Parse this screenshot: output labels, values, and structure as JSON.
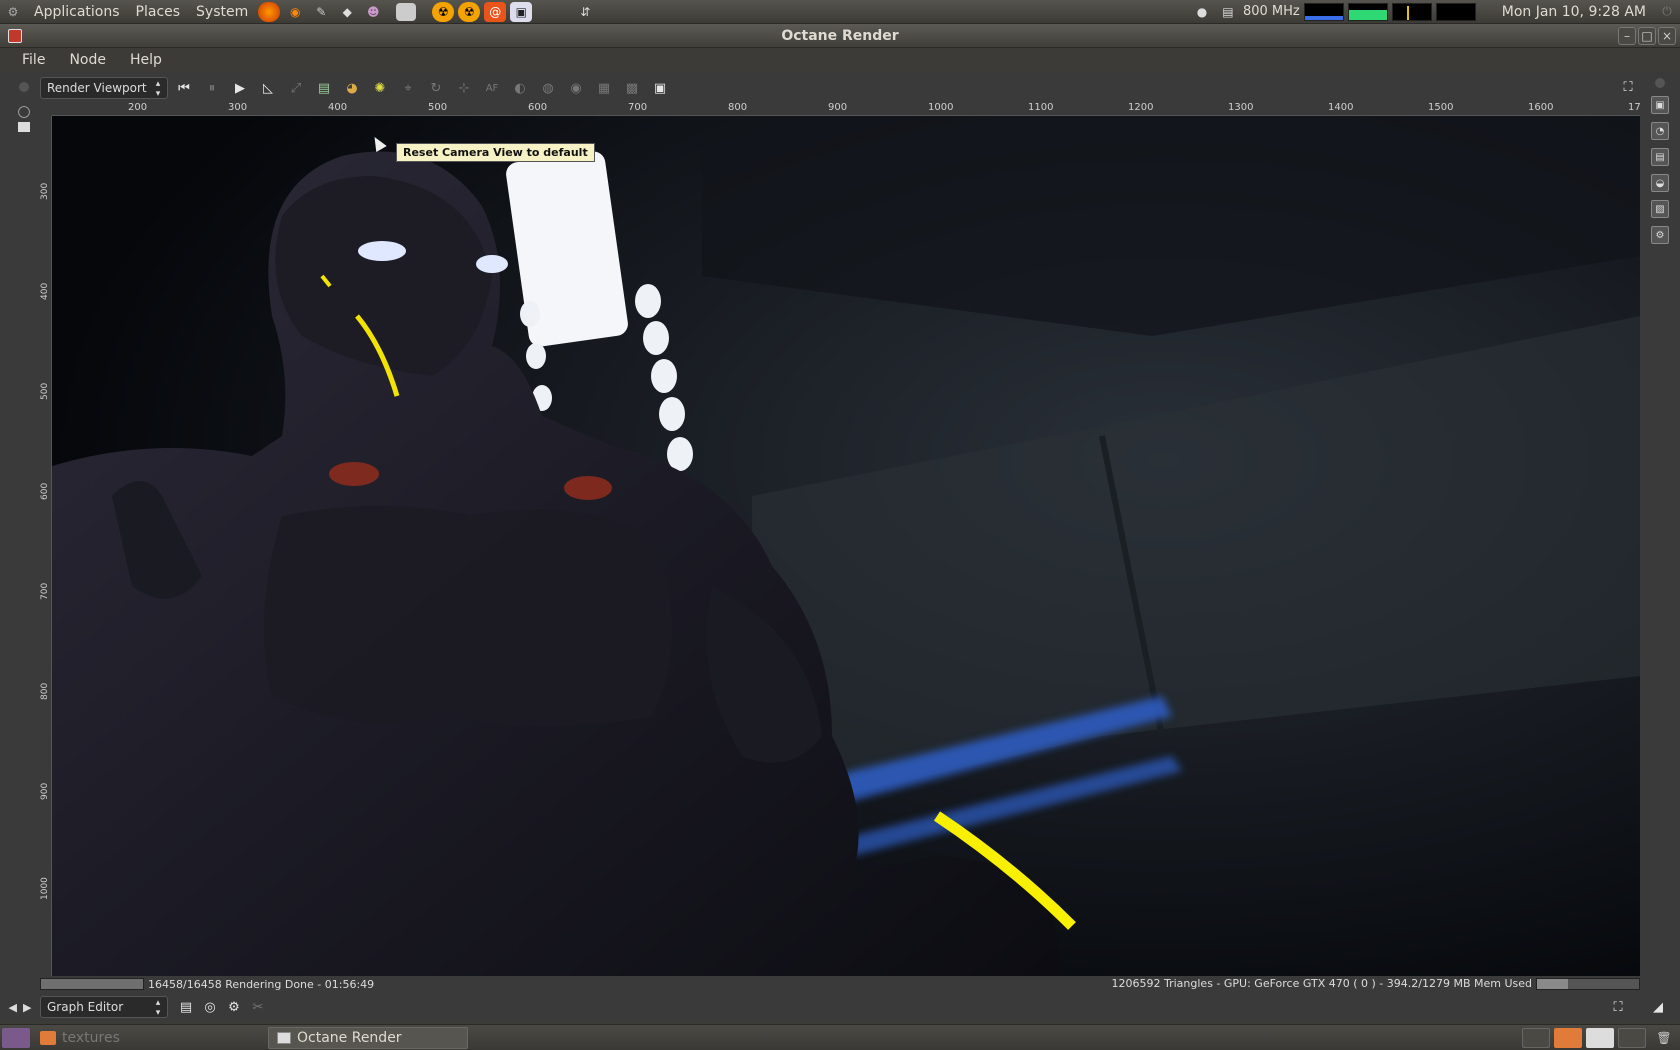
{
  "top_panel": {
    "menus": [
      "Applications",
      "Places",
      "System"
    ],
    "cpu_freq": "800 MHz",
    "clock": "Mon Jan 10,  9:28 AM"
  },
  "window": {
    "title": "Octane Render",
    "min_symbol": "–",
    "max_symbol": "□",
    "close_symbol": "×"
  },
  "menubar": [
    "File",
    "Node",
    "Help"
  ],
  "viewport_panel": {
    "selector": "Render Viewport",
    "tooltip": "Reset Camera View to default"
  },
  "ruler": {
    "h_labels": [
      "200",
      "300",
      "400",
      "500",
      "600",
      "700",
      "800",
      "900",
      "1000",
      "1100",
      "1200",
      "1300",
      "1400",
      "1500",
      "1600",
      "17"
    ],
    "v_labels": [
      "300",
      "400",
      "500",
      "600",
      "700",
      "800",
      "900",
      "1000"
    ]
  },
  "status": {
    "left": "16458/16458 Rendering Done - 01:56:49",
    "right": "1206592 Triangles - GPU: GeForce GTX 470 ( 0 ) - 394.2/1279 MB Mem Used",
    "mem_used_mb": 394.2,
    "mem_total_mb": 1279
  },
  "graph_panel": {
    "selector": "Graph Editor"
  },
  "taskbar": {
    "tasks": [
      "textures",
      "Octane Render"
    ]
  },
  "icons": {
    "first": "⏮",
    "pause": "⏸",
    "play": "▶",
    "fullscreen": "⛶",
    "updown": "▴▾",
    "left": "◀",
    "right": "▶"
  }
}
